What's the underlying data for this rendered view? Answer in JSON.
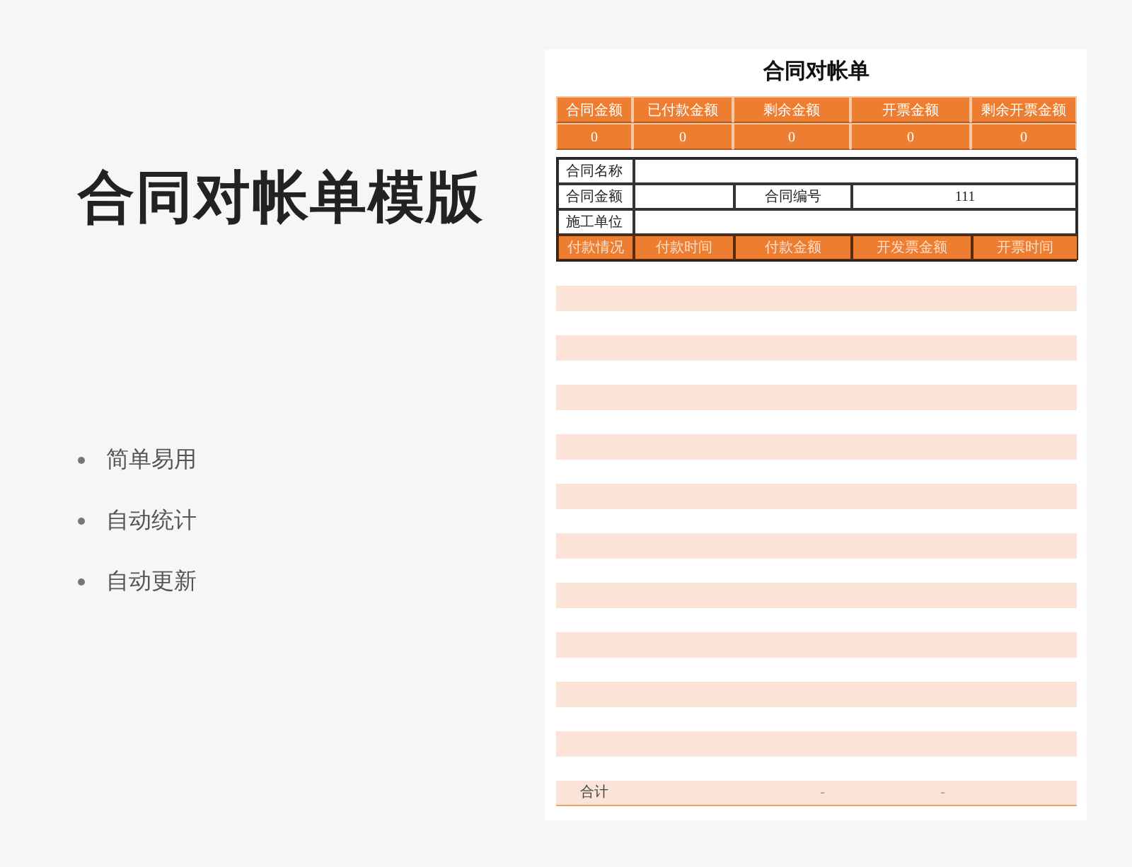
{
  "title": "合同对帐单模版",
  "features": [
    "简单易用",
    "自动统计",
    "自动更新"
  ],
  "sheet": {
    "title": "合同对帐单",
    "summary": {
      "columns": [
        "合同金额",
        "已付款金额",
        "剩余金额",
        "开票金额",
        "剩余开票金额"
      ],
      "values": [
        "0",
        "0",
        "0",
        "0",
        "0"
      ]
    },
    "info": {
      "contract_name_label": "合同名称",
      "contract_amount_label": "合同金额",
      "contract_number_label": "合同编号",
      "contract_number": "111",
      "contractor_label": "施工单位"
    },
    "payment_columns": [
      "付款情况",
      "付款时间",
      "付款金额",
      "开发票金额",
      "开票时间"
    ],
    "total_row": {
      "label": "合计",
      "column_3": "-",
      "column_4": "-"
    }
  }
}
